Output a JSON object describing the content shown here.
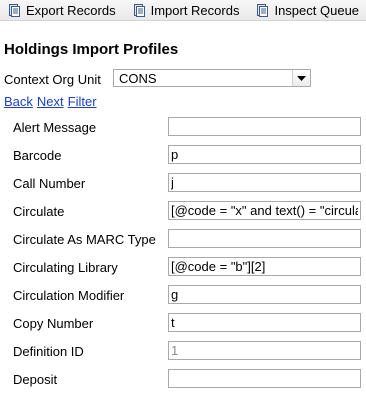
{
  "toolbar": {
    "buttons": [
      {
        "label": "Export Records",
        "icon": "document-icon"
      },
      {
        "label": "Import Records",
        "icon": "document-icon"
      },
      {
        "label": "Inspect Queue",
        "icon": "document-icon"
      }
    ]
  },
  "page": {
    "title": "Holdings Import Profiles"
  },
  "context_org": {
    "label": "Context Org Unit",
    "selected": "CONS"
  },
  "nav": {
    "back": "Back",
    "next": "Next",
    "filter": "Filter"
  },
  "fields": [
    {
      "label": "Alert Message",
      "value": ""
    },
    {
      "label": "Barcode",
      "value": "p"
    },
    {
      "label": "Call Number",
      "value": "j"
    },
    {
      "label": "Circulate",
      "value": "[@code = \"x\" and text() = \"circula"
    },
    {
      "label": "Circulate As MARC Type",
      "value": ""
    },
    {
      "label": "Circulating Library",
      "value": "[@code = \"b\"][2]"
    },
    {
      "label": "Circulation Modifier",
      "value": "g"
    },
    {
      "label": "Copy Number",
      "value": "t"
    },
    {
      "label": "Definition ID",
      "value": "1",
      "readonly": true
    },
    {
      "label": "Deposit",
      "value": ""
    }
  ]
}
